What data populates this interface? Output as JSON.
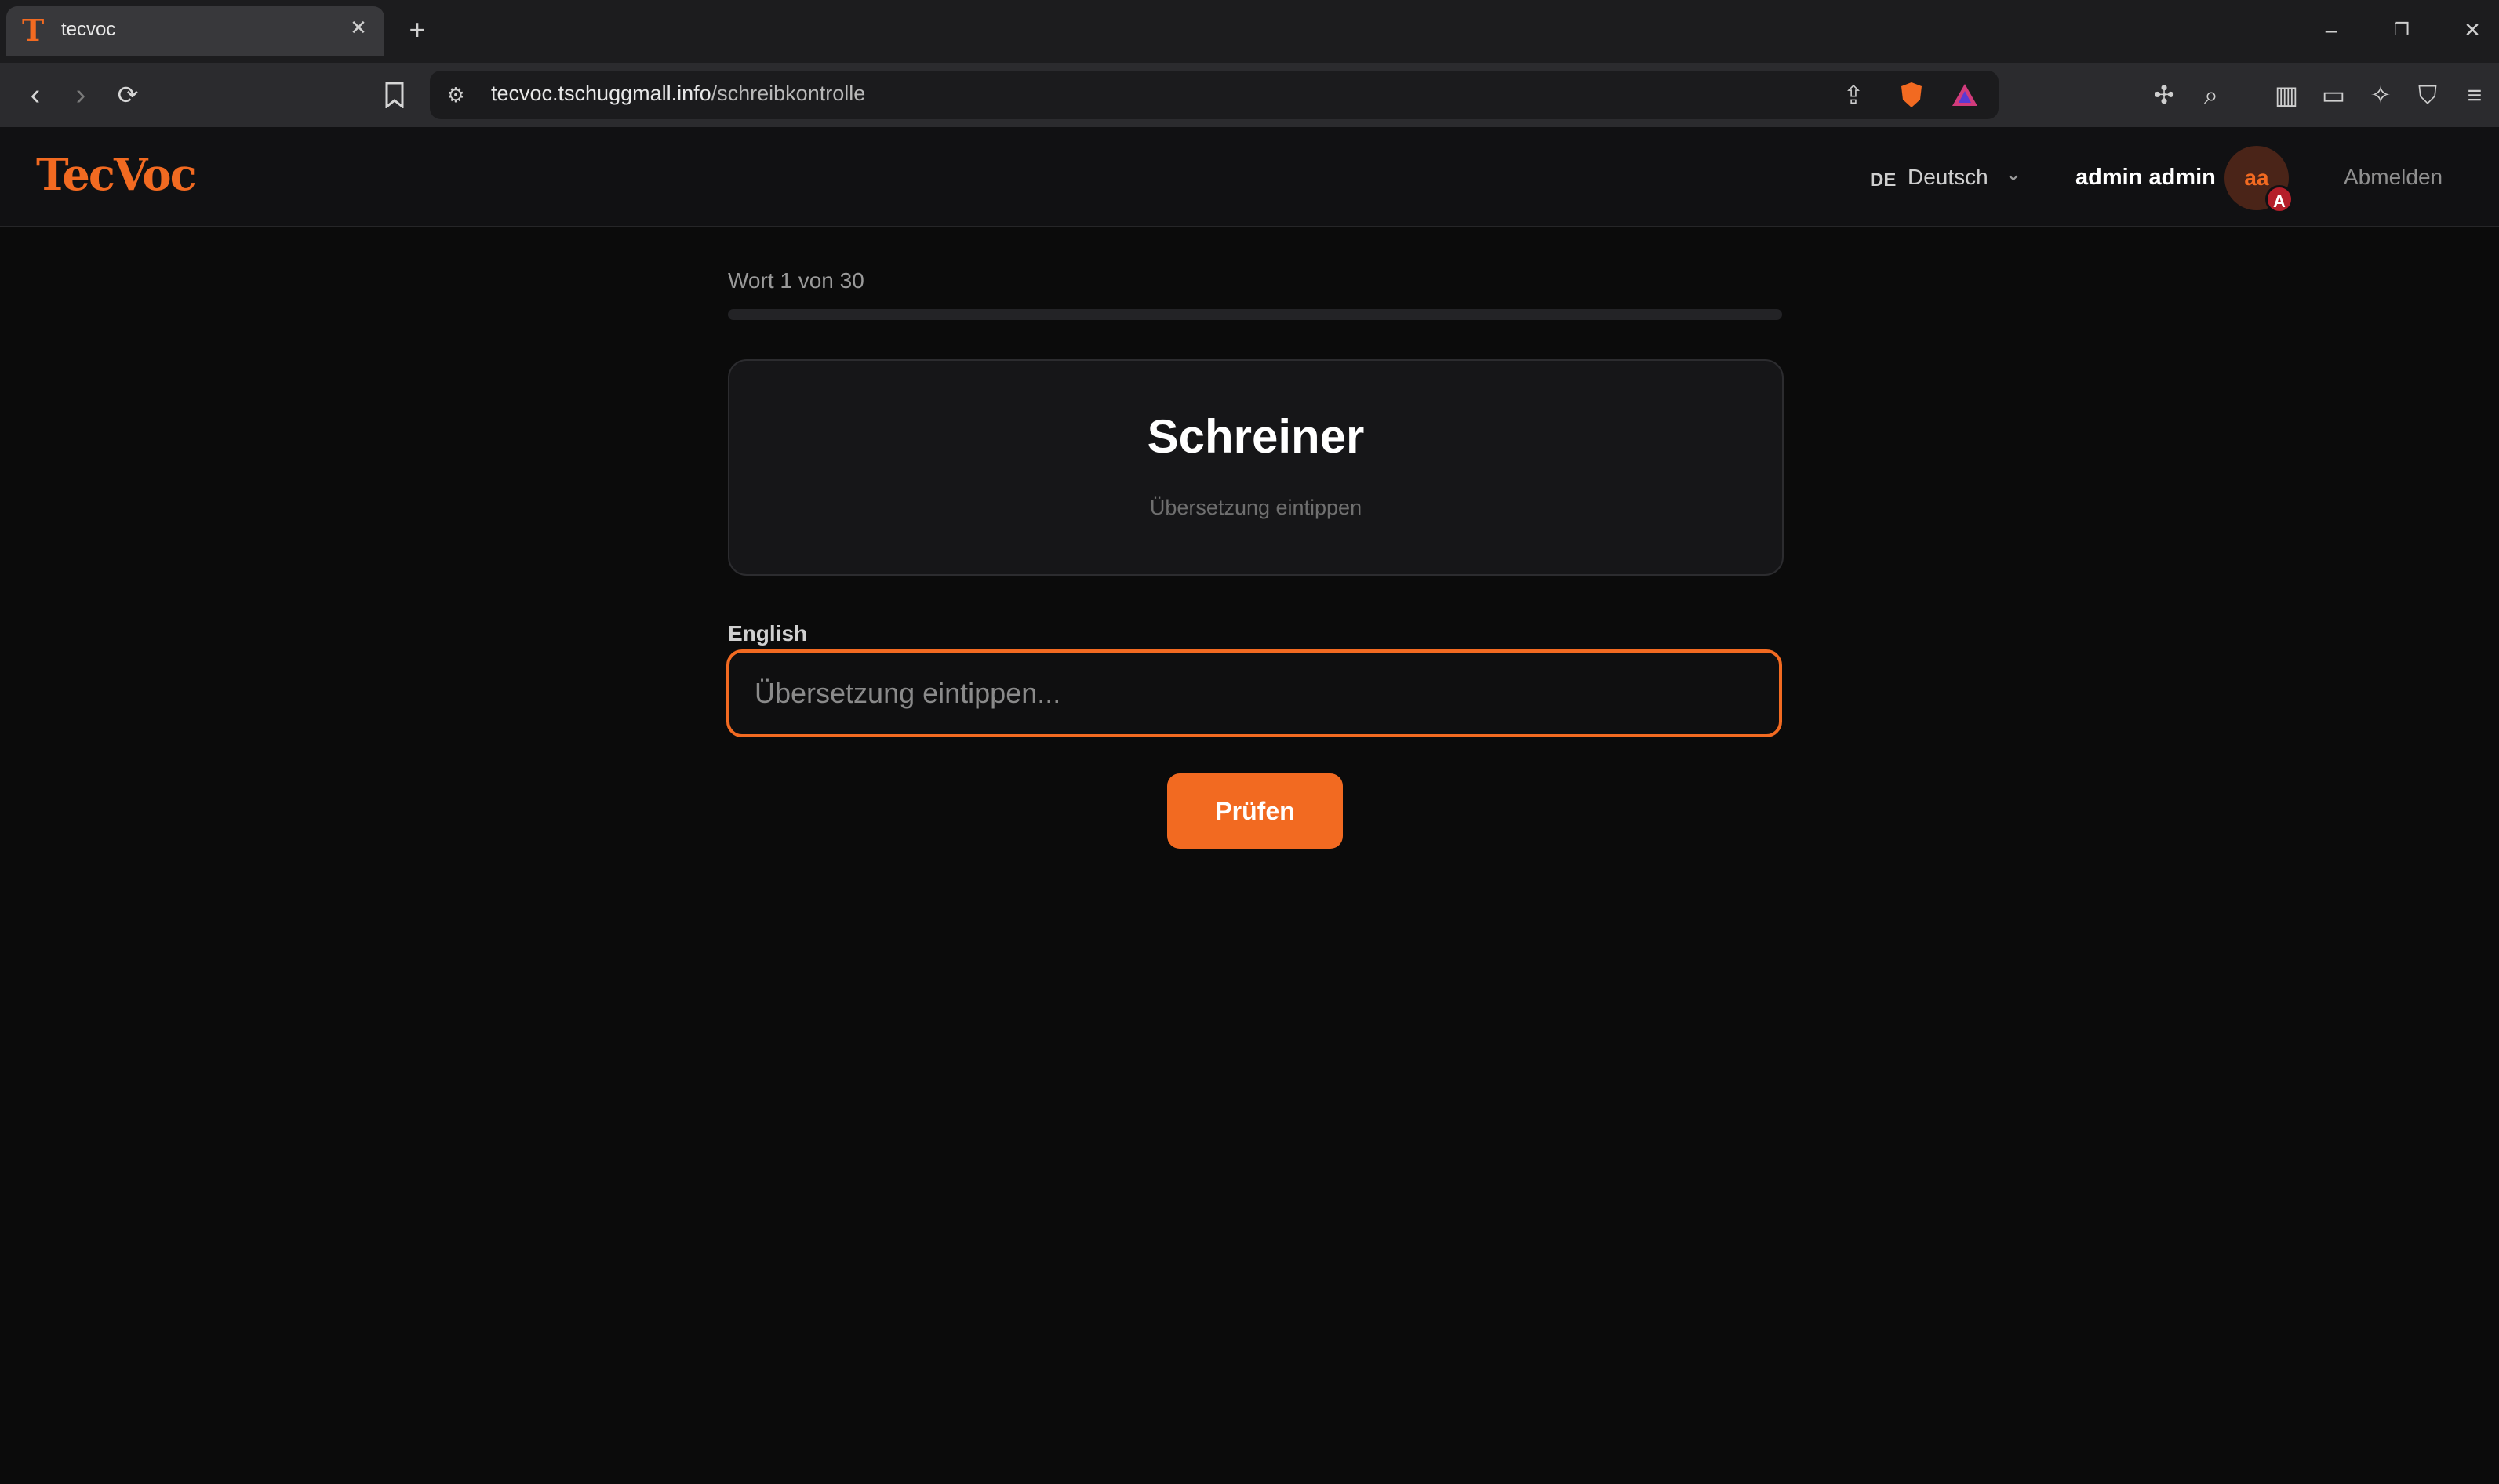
{
  "browser": {
    "tab_title": "tecvoc",
    "tab_favicon": "T",
    "url_host": "tecvoc.tschuggmall.info",
    "url_path": "/schreibkontrolle",
    "icons": [
      "back-icon",
      "forward-icon",
      "reload-icon",
      "bookmark-icon",
      "site-info-icon",
      "share-icon",
      "brave-shield-icon",
      "brave-rewards-icon",
      "extensions-icon",
      "tab-search-icon",
      "sidebar-icon",
      "wallet-icon",
      "leo-ai-icon",
      "vpn-icon",
      "menu-icon"
    ]
  },
  "header": {
    "logo": "TecVoc",
    "lang_code": "DE",
    "lang_name": "Deutsch",
    "username": "admin admin",
    "avatar_initials": "aa",
    "avatar_badge": "A",
    "logout": "Abmelden"
  },
  "quiz": {
    "progress_label": "Wort 1 von 30",
    "progress_current": 1,
    "progress_total": 30,
    "progress_fraction": 0.0,
    "word": "Schreiner",
    "hint": "Übersetzung eintippen",
    "field_label": "English",
    "input_placeholder": "Übersetzung eintippen...",
    "input_value": "",
    "check_button": "Prüfen"
  },
  "colors": {
    "accent": "#f26a21",
    "background": "#0b0b0b",
    "card": "#161618"
  }
}
